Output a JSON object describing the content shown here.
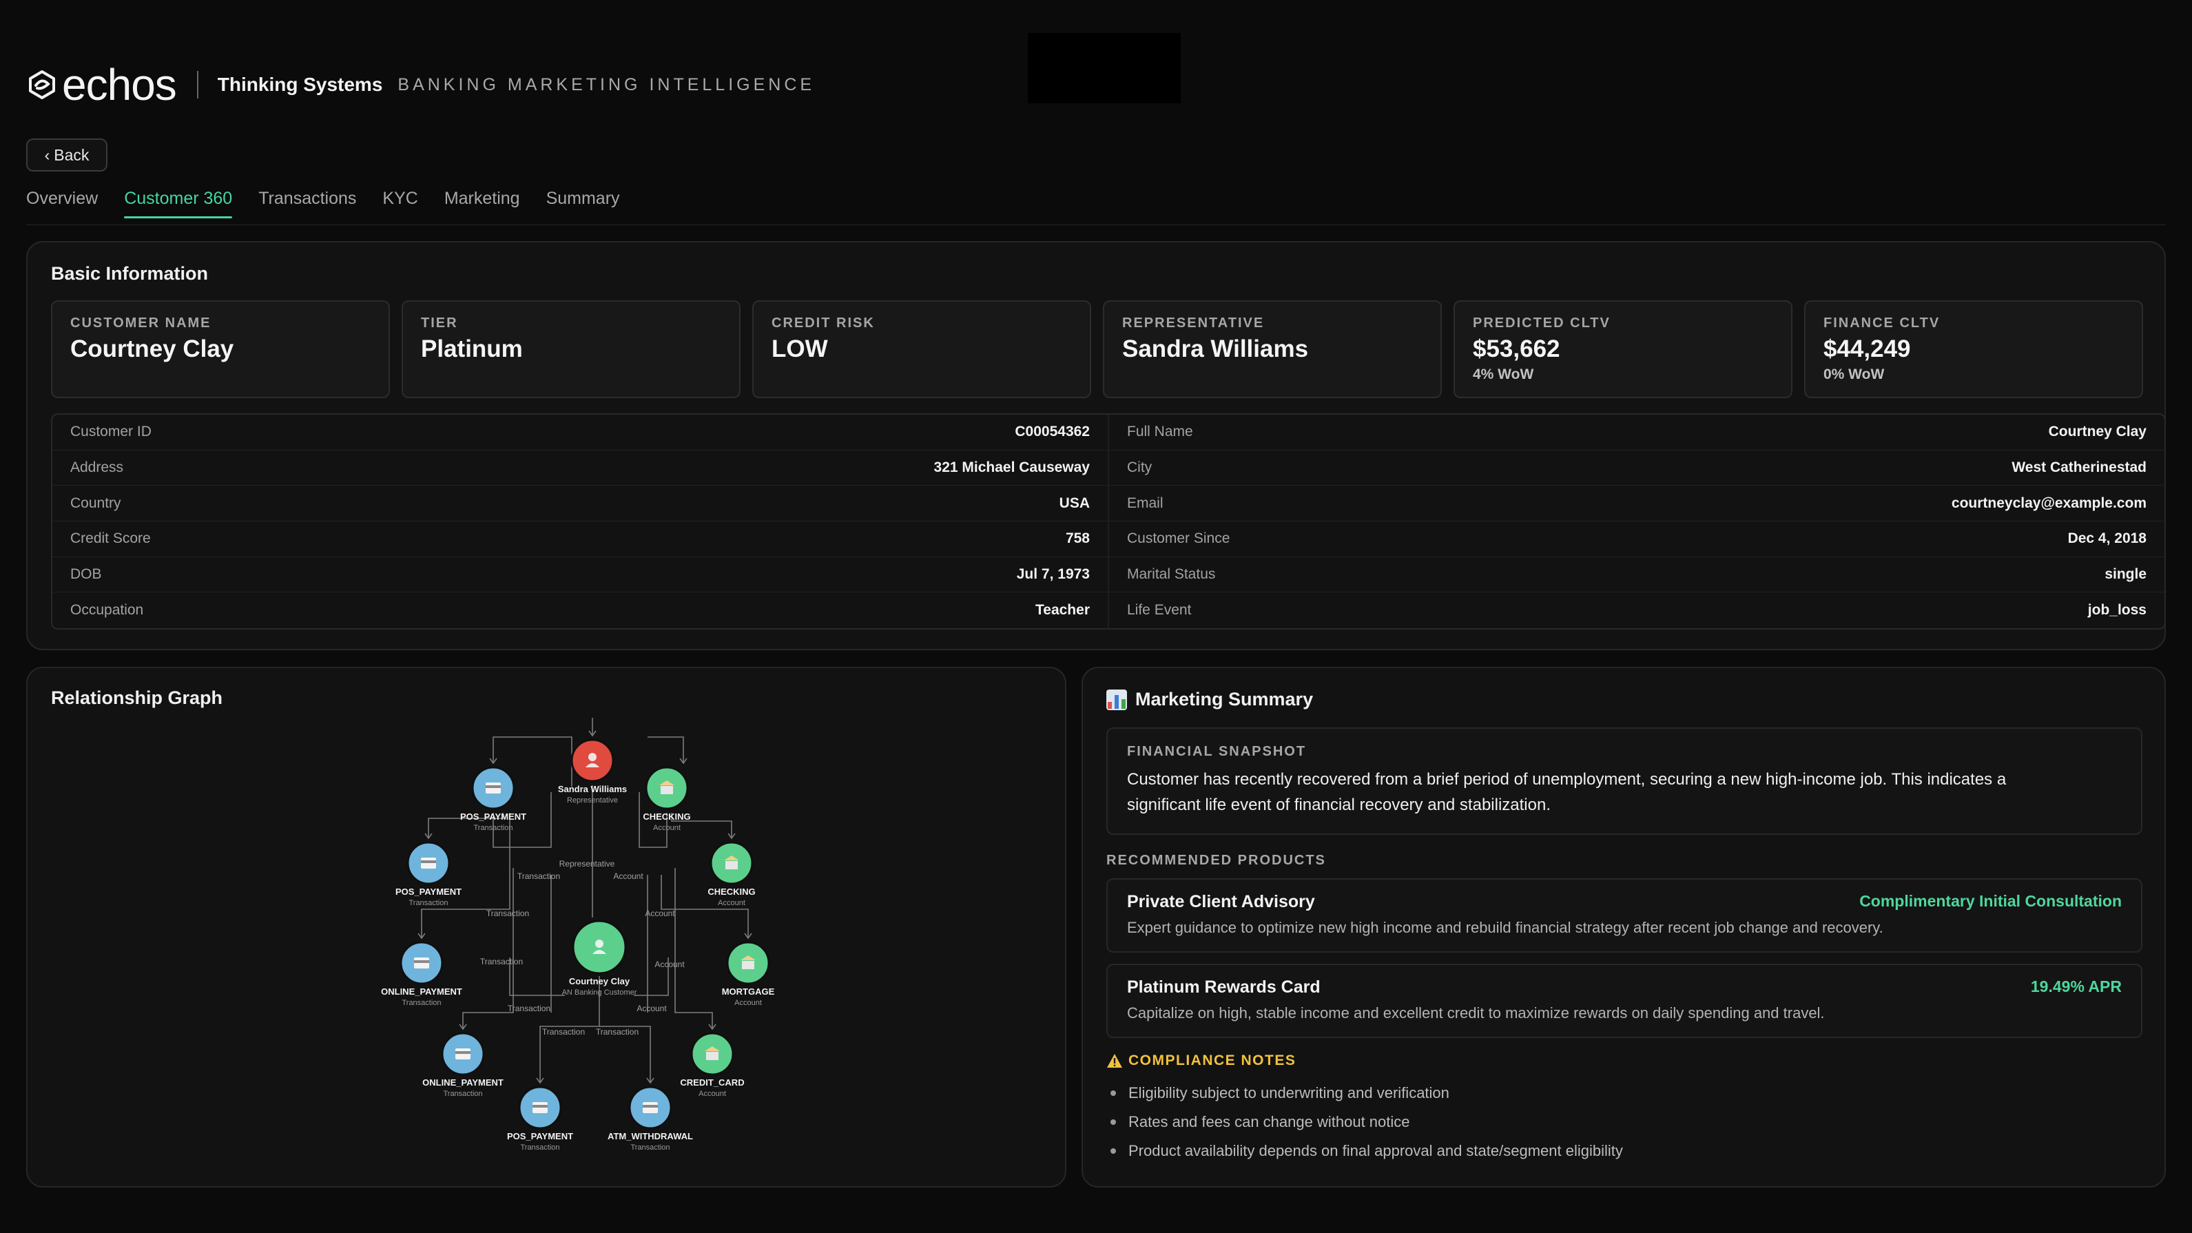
{
  "header": {
    "logo_text": "echos",
    "brand_name": "Thinking Systems",
    "brand_subtitle": "BANKING MARKETING INTELLIGENCE"
  },
  "back_button": {
    "label": "Back",
    "icon": "chevron-left-icon"
  },
  "tabs": [
    {
      "label": "Overview",
      "active": false
    },
    {
      "label": "Customer 360",
      "active": true
    },
    {
      "label": "Transactions",
      "active": false
    },
    {
      "label": "KYC",
      "active": false
    },
    {
      "label": "Marketing",
      "active": false
    },
    {
      "label": "Summary",
      "active": false
    }
  ],
  "basic_info": {
    "title": "Basic Information",
    "stats": [
      {
        "label": "CUSTOMER NAME",
        "value": "Courtney Clay",
        "sub": ""
      },
      {
        "label": "TIER",
        "value": "Platinum",
        "sub": ""
      },
      {
        "label": "CREDIT RISK",
        "value": "LOW",
        "sub": ""
      },
      {
        "label": "REPRESENTATIVE",
        "value": "Sandra Williams",
        "sub": ""
      },
      {
        "label": "PREDICTED CLTV",
        "value": "$53,662",
        "sub": "4% WoW"
      },
      {
        "label": "FINANCE CLTV",
        "value": "$44,249",
        "sub": "0% WoW"
      }
    ],
    "left_rows": [
      {
        "key": "Customer ID",
        "value": "C00054362"
      },
      {
        "key": "Address",
        "value": "321 Michael Causeway"
      },
      {
        "key": "Country",
        "value": "USA"
      },
      {
        "key": "Credit Score",
        "value": "758"
      },
      {
        "key": "DOB",
        "value": "Jul 7, 1973"
      },
      {
        "key": "Occupation",
        "value": "Teacher"
      }
    ],
    "right_rows": [
      {
        "key": "Full Name",
        "value": "Courtney Clay"
      },
      {
        "key": "City",
        "value": "West Catherinestad"
      },
      {
        "key": "Email",
        "value": "courtneyclay@example.com"
      },
      {
        "key": "Customer Since",
        "value": "Dec 4, 2018"
      },
      {
        "key": "Marital Status",
        "value": "single"
      },
      {
        "key": "Life Event",
        "value": "job_loss"
      }
    ]
  },
  "relationship_graph": {
    "title": "Relationship Graph",
    "colors": {
      "customer": "#5ccf8d",
      "representative": "#e04a3f",
      "account": "#5ccf8d",
      "transaction": "#6fb4dc"
    },
    "center": {
      "name": "Courtney Clay",
      "type": "AN Banking Customer",
      "icon": "person-icon"
    },
    "representative": {
      "name": "Sandra Williams",
      "type": "Representative",
      "icon": "person-icon"
    },
    "nodes": [
      {
        "name": "POS_PAYMENT",
        "type": "Transaction",
        "kind": "transaction"
      },
      {
        "name": "CHECKING",
        "type": "Account",
        "kind": "account"
      },
      {
        "name": "POS_PAYMENT",
        "type": "Transaction",
        "kind": "transaction"
      },
      {
        "name": "CHECKING",
        "type": "Account",
        "kind": "account"
      },
      {
        "name": "ONLINE_PAYMENT",
        "type": "Transaction",
        "kind": "transaction"
      },
      {
        "name": "MORTGAGE",
        "type": "Account",
        "kind": "account"
      },
      {
        "name": "ONLINE_PAYMENT",
        "type": "Transaction",
        "kind": "transaction"
      },
      {
        "name": "CREDIT_CARD",
        "type": "Account",
        "kind": "account"
      },
      {
        "name": "POS_PAYMENT",
        "type": "Transaction",
        "kind": "transaction"
      },
      {
        "name": "ATM_WITHDRAWAL",
        "type": "Transaction",
        "kind": "transaction"
      }
    ],
    "edge_labels": [
      "Representative",
      "Transaction",
      "Account",
      "Transaction",
      "Account",
      "Transaction",
      "Account",
      "Transaction",
      "Account",
      "Transaction",
      "Transaction"
    ]
  },
  "marketing": {
    "title": "Marketing Summary",
    "icon": "bar-chart-icon",
    "snapshot_label": "FINANCIAL SNAPSHOT",
    "snapshot_line1": "Customer has recently recovered from a brief period of unemployment, securing a new high-income job. This indicates a",
    "snapshot_line2": "significant life event of financial recovery and stabilization.",
    "recommended_label": "RECOMMENDED PRODUCTS",
    "products": [
      {
        "name": "Private Client Advisory",
        "offer": "Complimentary Initial Consultation",
        "desc": "Expert guidance to optimize new high income and rebuild financial strategy after recent job change and recovery."
      },
      {
        "name": "Platinum Rewards Card",
        "offer": "19.49% APR",
        "desc": "Capitalize on high, stable income and excellent credit to maximize rewards on daily spending and travel."
      }
    ],
    "compliance_label": "COMPLIANCE NOTES",
    "compliance_icon": "warning-icon",
    "compliance_notes": [
      "Eligibility subject to underwriting and verification",
      "Rates and fees can change without notice",
      "Product availability depends on final approval and state/segment eligibility"
    ]
  }
}
